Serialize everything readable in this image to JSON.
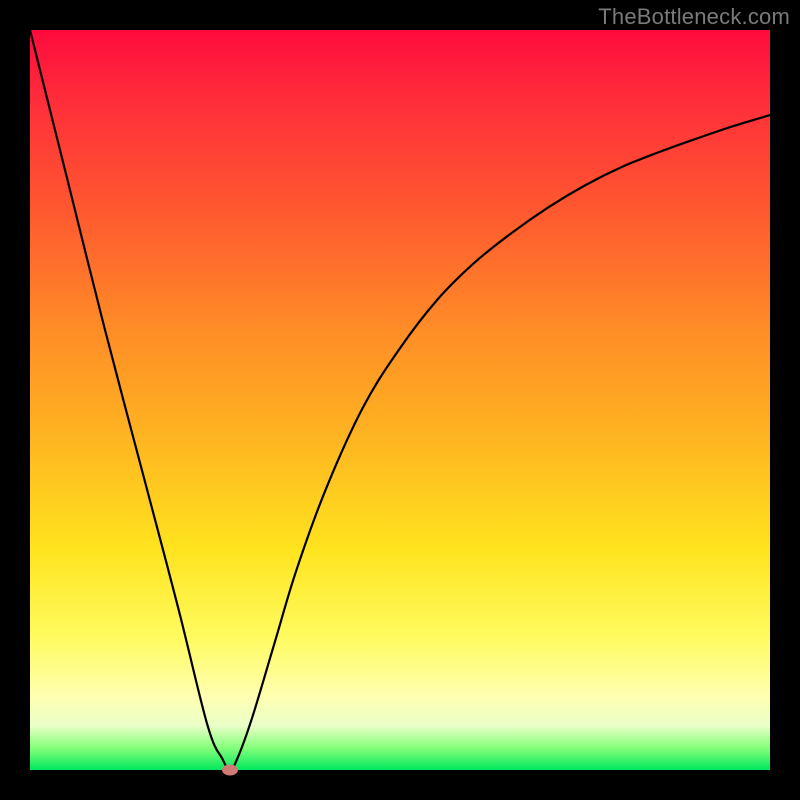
{
  "watermark": "TheBottleneck.com",
  "chart_data": {
    "type": "line",
    "title": "",
    "xlabel": "",
    "ylabel": "",
    "xlim": [
      0,
      100
    ],
    "ylim": [
      0,
      100
    ],
    "note": "V-shaped bottleneck curve on red→green vertical gradient. Single minimum point marked by small oval. No axis ticks or labels shown.",
    "series": [
      {
        "name": "bottleneck-curve",
        "x": [
          0,
          5,
          10,
          15,
          20,
          24,
          26,
          27,
          28,
          30,
          33,
          36,
          40,
          45,
          50,
          55,
          60,
          65,
          70,
          75,
          80,
          85,
          90,
          95,
          100
        ],
        "values": [
          100,
          80,
          60,
          41,
          22,
          6,
          1.5,
          0,
          1.5,
          7,
          17,
          27,
          38,
          49,
          57,
          63.5,
          68.5,
          72.5,
          76,
          79,
          81.5,
          83.5,
          85.3,
          87,
          88.5
        ]
      }
    ],
    "marker": {
      "x": 27,
      "y": 0
    },
    "gradient_colors": {
      "top": "#ff0b3d",
      "mid_upper": "#ff8b27",
      "mid": "#ffe31e",
      "lower": "#ffffb0",
      "bottom": "#00e85e"
    }
  }
}
